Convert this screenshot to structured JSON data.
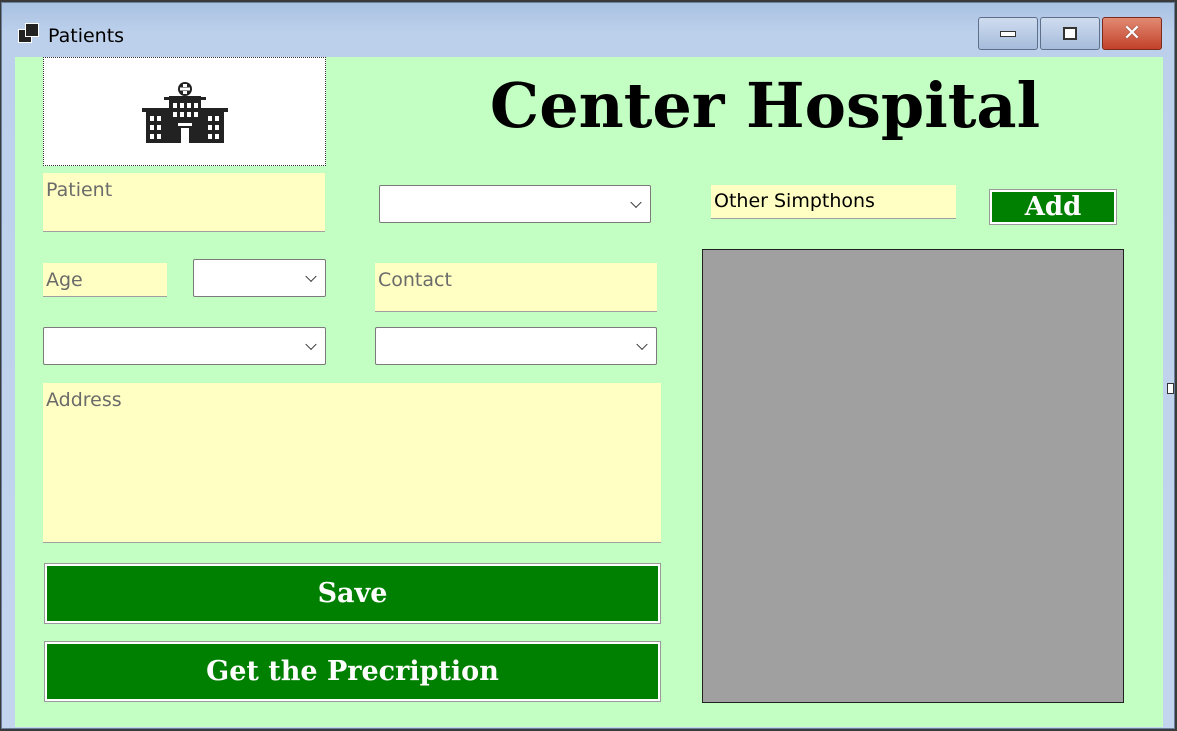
{
  "window": {
    "title": "Patients",
    "minimize_label": "",
    "maximize_label": "",
    "close_glyph": "✕"
  },
  "header": {
    "hospital_name": "Center Hospital",
    "logo_icon": "hospital-building-icon"
  },
  "form": {
    "patient_placeholder": "Patient",
    "age_placeholder": "Age",
    "contact_placeholder": "Contact",
    "address_placeholder": "Address",
    "top_combo_value": "",
    "age_combo_value": "",
    "left_combo_value": "",
    "right_combo_value": ""
  },
  "symptoms": {
    "other_value": "Other Simpthons",
    "add_label": "Add"
  },
  "actions": {
    "save_label": "Save",
    "prescription_label": "Get the Precription"
  },
  "colors": {
    "background": "#c3fec3",
    "field": "#ffffc3",
    "button": "#008000",
    "list_panel": "#a0a0a0"
  }
}
